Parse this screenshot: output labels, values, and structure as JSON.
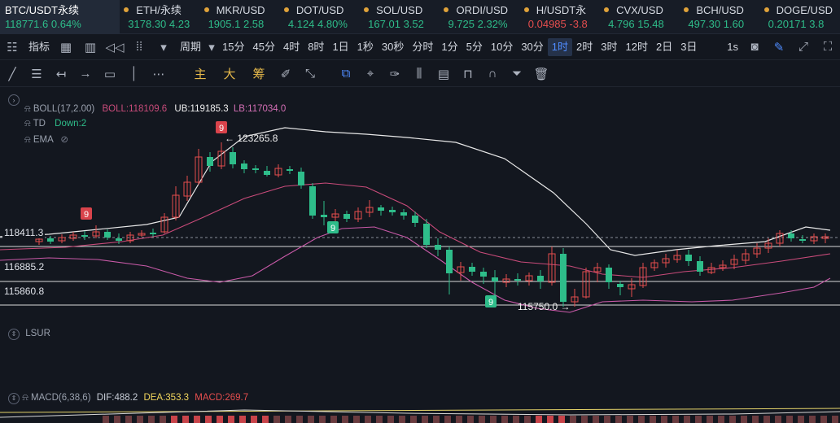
{
  "tickers": [
    {
      "symbol": "BTC/USDT永续",
      "price": "118771.6",
      "change": "0.64%",
      "active": true
    },
    {
      "symbol": "ETH/永续",
      "price": "3178.30",
      "change": "4.23"
    },
    {
      "symbol": "MKR/USD",
      "price": "1905.1",
      "change": "2.58"
    },
    {
      "symbol": "DOT/USD",
      "price": "4.124",
      "change": "4.80%"
    },
    {
      "symbol": "SOL/USD",
      "price": "167.01",
      "change": "3.52"
    },
    {
      "symbol": "ORDI/USD",
      "price": "9.725",
      "change": "2.32%"
    },
    {
      "symbol": "H/USDT永",
      "price": "0.04985",
      "change": "-3.8"
    },
    {
      "symbol": "CVX/USD",
      "price": "4.796",
      "change": "15.48"
    },
    {
      "symbol": "BCH/USD",
      "price": "497.30",
      "change": "1.60"
    },
    {
      "symbol": "DOGE/USD",
      "price": "0.20171",
      "change": "3.8"
    }
  ],
  "toolbar": {
    "indicators_label": "指标",
    "period_label": "周期",
    "timeframes": [
      "15分",
      "45分",
      "4时",
      "8时",
      "1日",
      "1秒",
      "30秒",
      "分时",
      "1分",
      "5分",
      "10分",
      "30分",
      "1时",
      "2时",
      "3时",
      "12时",
      "2日",
      "3日"
    ],
    "selected_timeframe": "1时",
    "right_label": "1s"
  },
  "drawbar": {
    "main_label": "主",
    "big_label": "大",
    "chip_label": "筹"
  },
  "legend": {
    "boll": {
      "name": "BOLL(17,2.00)",
      "boll": "BOLL:118109.6",
      "ub": "UB:119185.3",
      "lb": "LB:117034.0"
    },
    "td": {
      "name": "TD",
      "value": "Down:2"
    },
    "ema": {
      "name": "EMA"
    },
    "lsur": {
      "name": "LSUR"
    },
    "macd": {
      "name": "MACD(6,38,6)",
      "dif": "DIF:488.2",
      "dea": "DEA:353.3",
      "macd": "MACD:269.7"
    }
  },
  "price_levels": [
    {
      "label": "118411.3",
      "color": "#e0e3ea",
      "dashed": true
    },
    {
      "label": "116885.2",
      "color": "#d8d8d8"
    },
    {
      "label": "115860.8",
      "color": "#d8d8d8"
    }
  ],
  "annotations": {
    "high": "← 123265.8",
    "low": "115750.0 →",
    "td_marks": [
      "9",
      "9",
      "9",
      "9"
    ]
  },
  "colors": {
    "up": "#e64e4e",
    "down": "#2ebd8a",
    "ub_line": "#e8e8e8",
    "mid_line": "#c94b7a",
    "lb_line": "#c95aa8",
    "accent": "#4f8cff"
  }
}
